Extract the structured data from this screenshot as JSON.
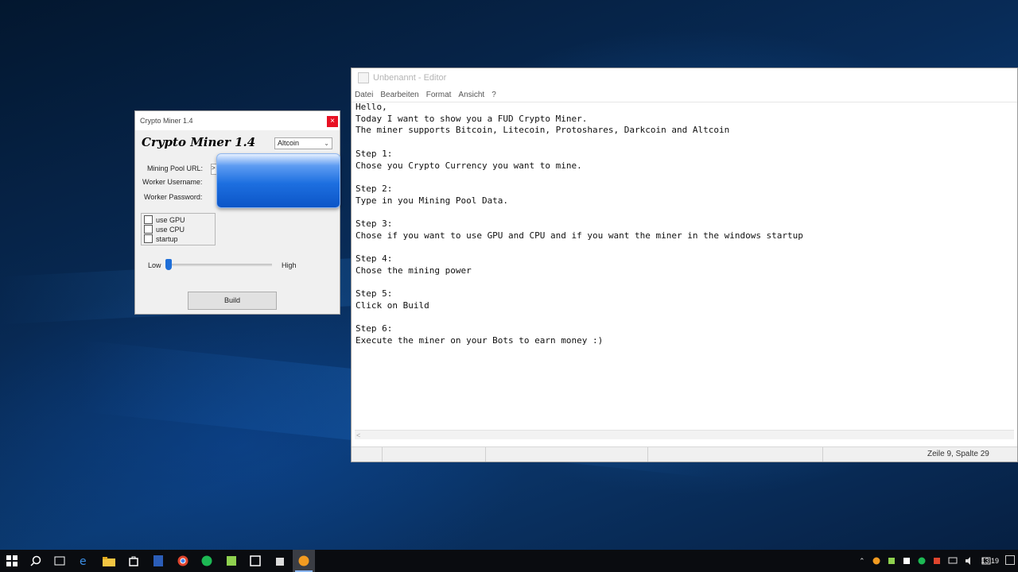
{
  "notepad": {
    "title": "Unbenannt - Editor",
    "menu": [
      "Datei",
      "Bearbeiten",
      "Format",
      "Ansicht",
      "?"
    ],
    "text": "Hello,\nToday I want to show you a FUD Crypto Miner.\nThe miner supports Bitcoin, Litecoin, Protoshares, Darkcoin and Altcoin\n\nStep 1:\nChose you Crypto Currency you want to mine.\n\nStep 2:\nType in you Mining Pool Data.\n\nStep 3:\nChose if you want to use GPU and CPU and if you want the miner in the windows startup\n\nStep 4:\nChose the mining power\n\nStep 5:\nClick on Build\n\nStep 6:\nExecute the miner on your Bots to earn money :)",
    "hscroll_left": "<",
    "status": "Zeile 9, Spalte 29"
  },
  "miner": {
    "title": "Crypto Miner 1.4",
    "close_glyph": "×",
    "logo": "Crypto Miner 1.4",
    "currency": "Altcoin",
    "pool_url_label": "Mining Pool URL:",
    "pool_url_value": ">",
    "worker_username_label": "Worker Username:",
    "worker_password_label": "Worker Password:",
    "checks": [
      {
        "label": "use GPU",
        "checked": false
      },
      {
        "label": "use CPU",
        "checked": false
      },
      {
        "label": "startup",
        "checked": false
      }
    ],
    "slider_low": "Low",
    "slider_high": "High",
    "slider_level": 0.0,
    "build_label": "Build"
  },
  "taskbar": {
    "clock": "13:19",
    "apps": [
      "start-icon",
      "search-icon",
      "task-view-icon",
      "edge-icon",
      "file-explorer-icon",
      "store-icon",
      "word-icon",
      "chrome-icon",
      "spotify-icon",
      "notepadpp-icon",
      "app-icon",
      "app-icon",
      "firefox-icon"
    ]
  }
}
